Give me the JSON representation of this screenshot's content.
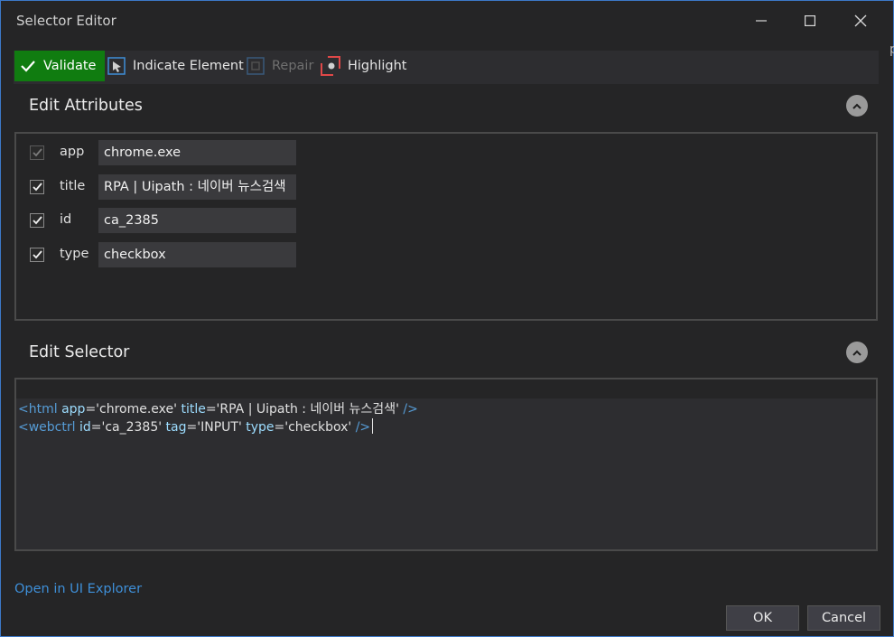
{
  "window": {
    "title": "Selector Editor",
    "edge_fragment": "p"
  },
  "toolbar": {
    "validate": "Validate",
    "indicate": "Indicate Element",
    "repair": "Repair",
    "highlight": "Highlight"
  },
  "edit_attributes": {
    "title": "Edit Attributes",
    "rows": [
      {
        "name": "app",
        "value": "chrome.exe",
        "checked": true,
        "enabled": false
      },
      {
        "name": "title",
        "value": "RPA | Uipath : 네이버 뉴스검색",
        "checked": true,
        "enabled": true
      },
      {
        "name": "id",
        "value": "ca_2385",
        "checked": true,
        "enabled": true
      },
      {
        "name": "type",
        "value": "checkbox",
        "checked": true,
        "enabled": true
      }
    ]
  },
  "edit_selector": {
    "title": "Edit Selector",
    "line1": {
      "open": "<html",
      "attr1": "app",
      "val1": "='chrome.exe'",
      "attr2": "title",
      "val2": "='RPA | Uipath : 네이버 뉴스검색'",
      "close": "/>"
    },
    "line2": {
      "open": "<webctrl",
      "attr1": "id",
      "val1": "='ca_2385'",
      "attr2": "tag",
      "val2": "='INPUT'",
      "attr3": "type",
      "val3": "='checkbox'",
      "close": "/>"
    }
  },
  "footer": {
    "explorer_link": "Open in UI Explorer",
    "ok": "OK",
    "cancel": "Cancel"
  },
  "colors": {
    "accent_green": "#107c10",
    "link_blue": "#3e8fd8",
    "tag_blue": "#569cd6",
    "attr_blue": "#9cdcfe"
  }
}
